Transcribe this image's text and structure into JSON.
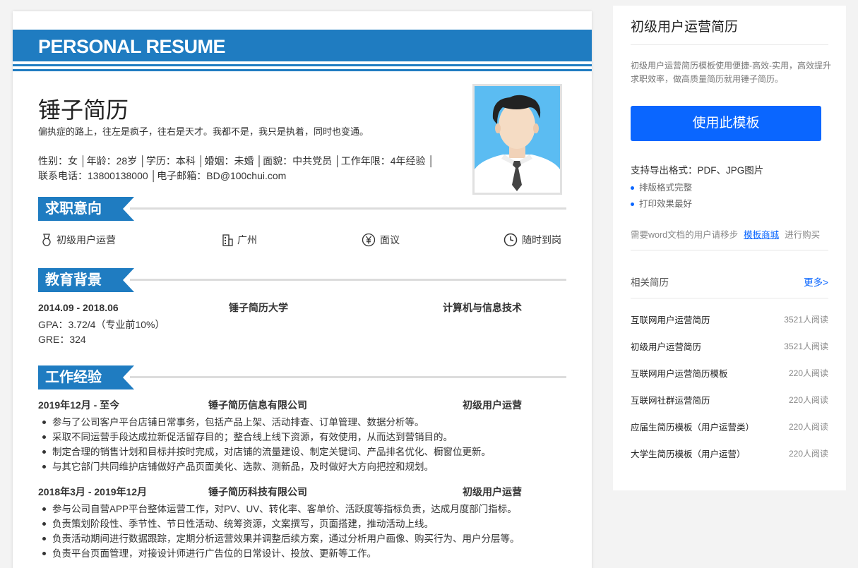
{
  "resume": {
    "header_title": "PERSONAL RESUME",
    "name": "锤子简历",
    "motto": "偏执症的路上，往左是疯子，往右是天才。我都不是，我只是执着，同时也变通。",
    "info_line1": "性别：女 │年龄：28岁 │学历：本科 │婚姻：未婚 │面貌：中共党员 │工作年限：4年经验 │",
    "info_line2": "联系电话：13800138000 │电子邮箱：BD@100chui.com",
    "sections": {
      "intent": "求职意向",
      "education": "教育背景",
      "work": "工作经验"
    },
    "intent": {
      "position": "初级用户运营",
      "city": "广州",
      "salary": "面议",
      "availability": "随时到岗"
    },
    "education": {
      "period": "2014.09 - 2018.06",
      "school": "锤子简历大学",
      "major": "计算机与信息技术",
      "gpa": "GPA：3.72/4（专业前10%）",
      "gre": "GRE：324"
    },
    "work": [
      {
        "period": "2019年12月 - 至今",
        "company": "锤子简历信息有限公司",
        "role": "初级用户运营",
        "bullets": [
          "参与了公司客户平台店铺日常事务，包括产品上架、活动排查、订单管理、数据分析等。",
          "采取不同运营手段达成拉新促活留存目的；整合线上线下资源，有效使用，从而达到营销目的。",
          "制定合理的销售计划和目标并按时完成，对店铺的流量建设、制定关键词、产品排名优化、橱窗位更新。",
          "与其它部门共同维护店铺做好产品页面美化、选款、测新品，及时做好大方向把控和规划。"
        ]
      },
      {
        "period": "2018年3月 - 2019年12月",
        "company": "锤子简历科技有限公司",
        "role": "初级用户运营",
        "bullets": [
          "参与公司自营APP平台整体运营工作，对PV、UV、转化率、客单价、活跃度等指标负责，达成月度部门指标。",
          "负责策划阶段性、季节性、节日性活动、统筹资源，文案撰写，页面搭建，推动活动上线。",
          "负责活动期间进行数据跟踪，定期分析运营效果并调整后续方案，通过分析用户画像、购买行为、用户分层等。",
          "负责平台页面管理，对接设计师进行广告位的日常设计、投放、更新等工作。"
        ]
      }
    ]
  },
  "panel": {
    "title": "初级用户运营简历",
    "description": "初级用户运营简历模板使用便捷-高效-实用，高效提升求职效率，做高质量简历就用锤子简历。",
    "button_label": "使用此模板",
    "formats": "支持导出格式：PDF、JPG图片",
    "features": [
      "排版格式完整",
      "打印效果最好"
    ],
    "word_prefix": "需要word文档的用户请移步",
    "word_link": "模板商城",
    "word_suffix": "进行购买",
    "related_title": "相关简历",
    "more_label": "更多>",
    "related": [
      {
        "title": "互联网用户运营简历",
        "reads": "3521人阅读"
      },
      {
        "title": "初级用户运营简历",
        "reads": "3521人阅读"
      },
      {
        "title": "互联网用户运营简历模板",
        "reads": "220人阅读"
      },
      {
        "title": "互联网社群运营简历",
        "reads": "220人阅读"
      },
      {
        "title": "应届生简历模板（用户运营类）",
        "reads": "220人阅读"
      },
      {
        "title": "大学生简历模板（用户运营）",
        "reads": "220人阅读"
      }
    ],
    "accent_color": "#0a66ff"
  },
  "theme": {
    "resume_blue": "#1f7cc1"
  }
}
